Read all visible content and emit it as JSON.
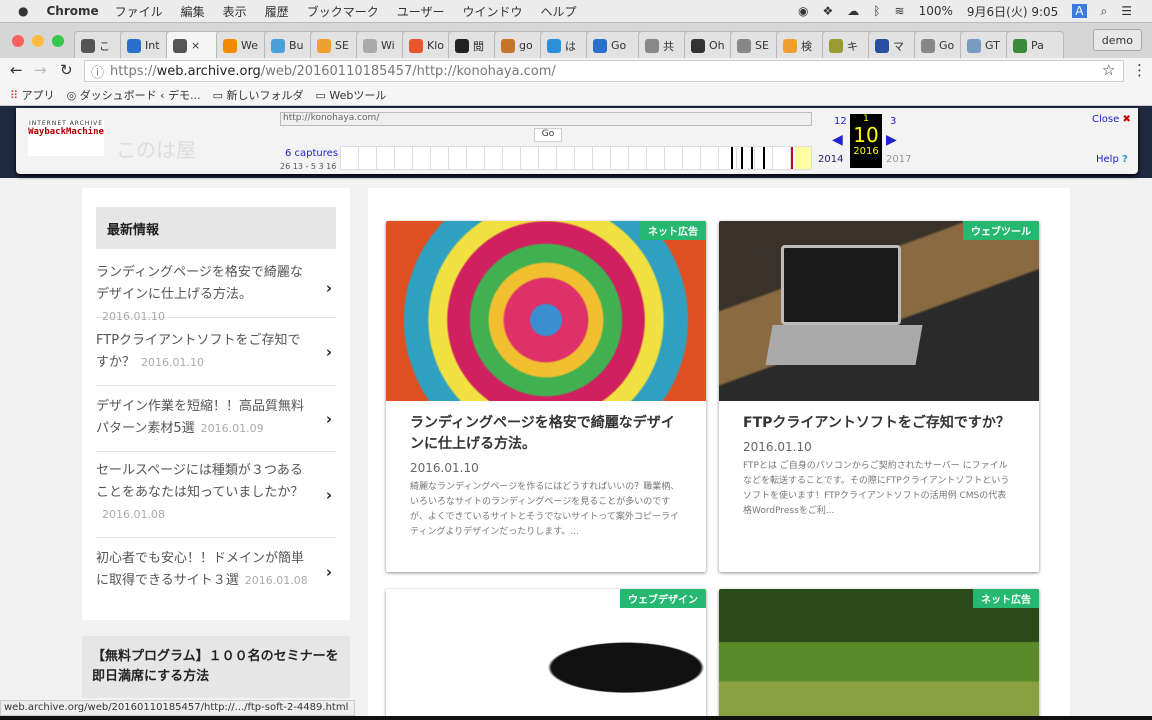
{
  "menubar": {
    "app": "Chrome",
    "items": [
      "ファイル",
      "編集",
      "表示",
      "履歴",
      "ブックマーク",
      "ユーザー",
      "ウインドウ",
      "ヘルプ"
    ],
    "battery": "100%",
    "datetime": "9月6日(火) 9:05",
    "input": "A"
  },
  "tabs": [
    {
      "label": "こ",
      "color": "#555"
    },
    {
      "label": "Int",
      "color": "#2a6fc9"
    },
    {
      "label": "×",
      "color": "#555"
    },
    {
      "label": "We",
      "color": "#f08a00"
    },
    {
      "label": "Bu",
      "color": "#4aa0d8"
    },
    {
      "label": "SE",
      "color": "#f0a030"
    },
    {
      "label": "Wi",
      "color": "#aaa"
    },
    {
      "label": "Klo",
      "color": "#e8542c"
    },
    {
      "label": "閲",
      "color": "#222"
    },
    {
      "label": "go",
      "color": "#c8732c"
    },
    {
      "label": "は",
      "color": "#2a8fd8"
    },
    {
      "label": "Go",
      "color": "#2a6fc9"
    },
    {
      "label": "共",
      "color": "#888"
    },
    {
      "label": "Oh",
      "color": "#333"
    },
    {
      "label": "SE",
      "color": "#888"
    },
    {
      "label": "検",
      "color": "#f0a030"
    },
    {
      "label": "キ",
      "color": "#9a9a30"
    },
    {
      "label": "マ",
      "color": "#2a4fa0"
    },
    {
      "label": "Go",
      "color": "#888"
    },
    {
      "label": "GT",
      "color": "#7a9ac0"
    },
    {
      "label": "Pa",
      "color": "#3a8a3a"
    }
  ],
  "profile": "demo",
  "address": {
    "scheme": "https://",
    "host": "web.archive.org",
    "path": "/web/20160110185457/http://konohaya.com/"
  },
  "bookmarks": [
    "アプリ",
    "ダッシュボード ‹ デモ...",
    "新しいフォルダ",
    "Webツール"
  ],
  "wayback": {
    "logo_top": "INTERNET ARCHIVE",
    "logo": "WaybackMachine",
    "url": "http://konohaya.com/",
    "go": "Go",
    "captures": "6 captures",
    "range": "26 13 - 5 3 16",
    "prev_month": "12",
    "cur_month": "1",
    "next_month": "3",
    "day": "10",
    "prev_year": "2014",
    "cur_year": "2016",
    "next_year": "2017",
    "close": "Close",
    "help": "Help",
    "site_name": "このは屋"
  },
  "sidebar": {
    "title": "最新情報",
    "items": [
      {
        "title": "ランディングページを格安で綺麗なデザインに仕上げる方法。",
        "date": "2016.01.10"
      },
      {
        "title": "FTPクライアントソフトをご存知ですか？",
        "date": "2016.01.10"
      },
      {
        "title": "デザイン作業を短縮！！高品質無料パターン素材5選",
        "date": "2016.01.09"
      },
      {
        "title": "セールスページには種類が３つあることをあなたは知っていましたか？",
        "date": "2016.01.08"
      },
      {
        "title": "初心者でも安心！！ドメインが簡単に取得できるサイト３選",
        "date": "2016.01.08"
      }
    ],
    "widget2": "【無料プログラム】１００名のセミナーを即日満席にする方法"
  },
  "cards": [
    {
      "badge": "ネット広告",
      "title": "ランディングページを格安で綺麗なデザインに仕上げる方法。",
      "date": "2016.01.10",
      "excerpt": "綺麗なランディングページを作るにはどうすればいいの？職業柄、いろいろなサイトのランディングページを見ることが多いのですが、よくできているサイトとそうでないサイトって案外コピーライティングよりデザインだったりします。..."
    },
    {
      "badge": "ウェブツール",
      "title": "FTPクライアントソフトをご存知ですか？",
      "date": "2016.01.10",
      "excerpt": "FTPとは ご自身のパソコンからご契約されたサーバー にファイルなどを転送することです。その際にFTPクライアントソフトというソフトを使います！FTPクライアントソフトの活用例 CMSの代表格WordPressをご利..."
    },
    {
      "badge": "ウェブデザイン"
    },
    {
      "badge": "ネット広告"
    }
  ],
  "status": "web.archive.org/web/20160110185457/http://.../ftp-soft-2-4489.html"
}
